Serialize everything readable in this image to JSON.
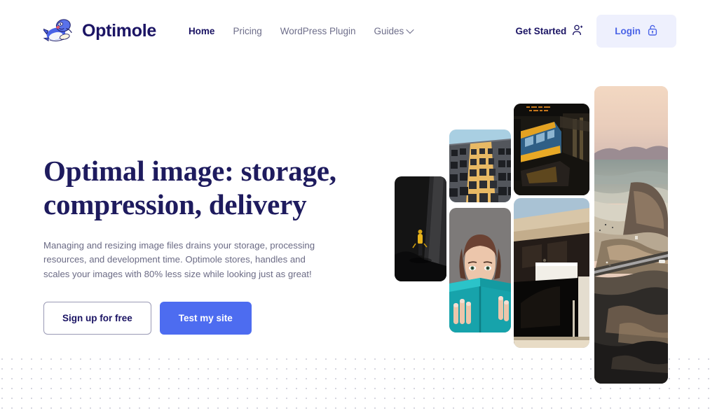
{
  "brand": {
    "name": "Optimole",
    "logo_icon": "mole-mascot-icon",
    "logo_color": "#4a63e7",
    "text_color": "#1b1464"
  },
  "nav": {
    "items": [
      {
        "label": "Home",
        "active": true,
        "has_caret": false
      },
      {
        "label": "Pricing",
        "active": false,
        "has_caret": false
      },
      {
        "label": "WordPress Plugin",
        "active": false,
        "has_caret": false
      },
      {
        "label": "Guides",
        "active": false,
        "has_caret": true
      }
    ]
  },
  "header_actions": {
    "get_started": {
      "label": "Get Started",
      "icon": "user-plus-icon"
    },
    "login": {
      "label": "Login",
      "icon": "padlock-open-icon",
      "background": "#eef0fd",
      "text_color": "#4a63e7"
    }
  },
  "hero": {
    "headline": "Optimal image: storage, compression, delivery",
    "paragraph": "Managing and resizing image files drains your storage, processing resources, and development time. Optimole stores, handles and scales your images with 80% less size while looking just as great!",
    "primary_cta": {
      "label": "Test my site",
      "color": "#4d6cf0"
    },
    "secondary_cta": {
      "label": "Sign up for free",
      "color": "#ffffff"
    },
    "headline_color": "#1e1b5e",
    "paragraph_color": "#6b6b85"
  },
  "collage": {
    "images": [
      {
        "name": "caver-in-dark-cave",
        "alt": "Person in yellow jacket exploring a dark cave"
      },
      {
        "name": "building-facade-upward",
        "alt": "Upward view of a building facade with golden light"
      },
      {
        "name": "train-at-night-station",
        "alt": "Blue and yellow train at a night station platform"
      },
      {
        "name": "woman-holding-teal-book",
        "alt": "Woman holding a teal book over her face"
      },
      {
        "name": "modern-architecture",
        "alt": "Modern architecture with beige roof and dark glass"
      },
      {
        "name": "coastal-aerial-sunset",
        "alt": "Aerial coastline at sunset with road along cliffs"
      }
    ]
  },
  "background": {
    "dot_pattern_color": "#c9c9d6"
  }
}
